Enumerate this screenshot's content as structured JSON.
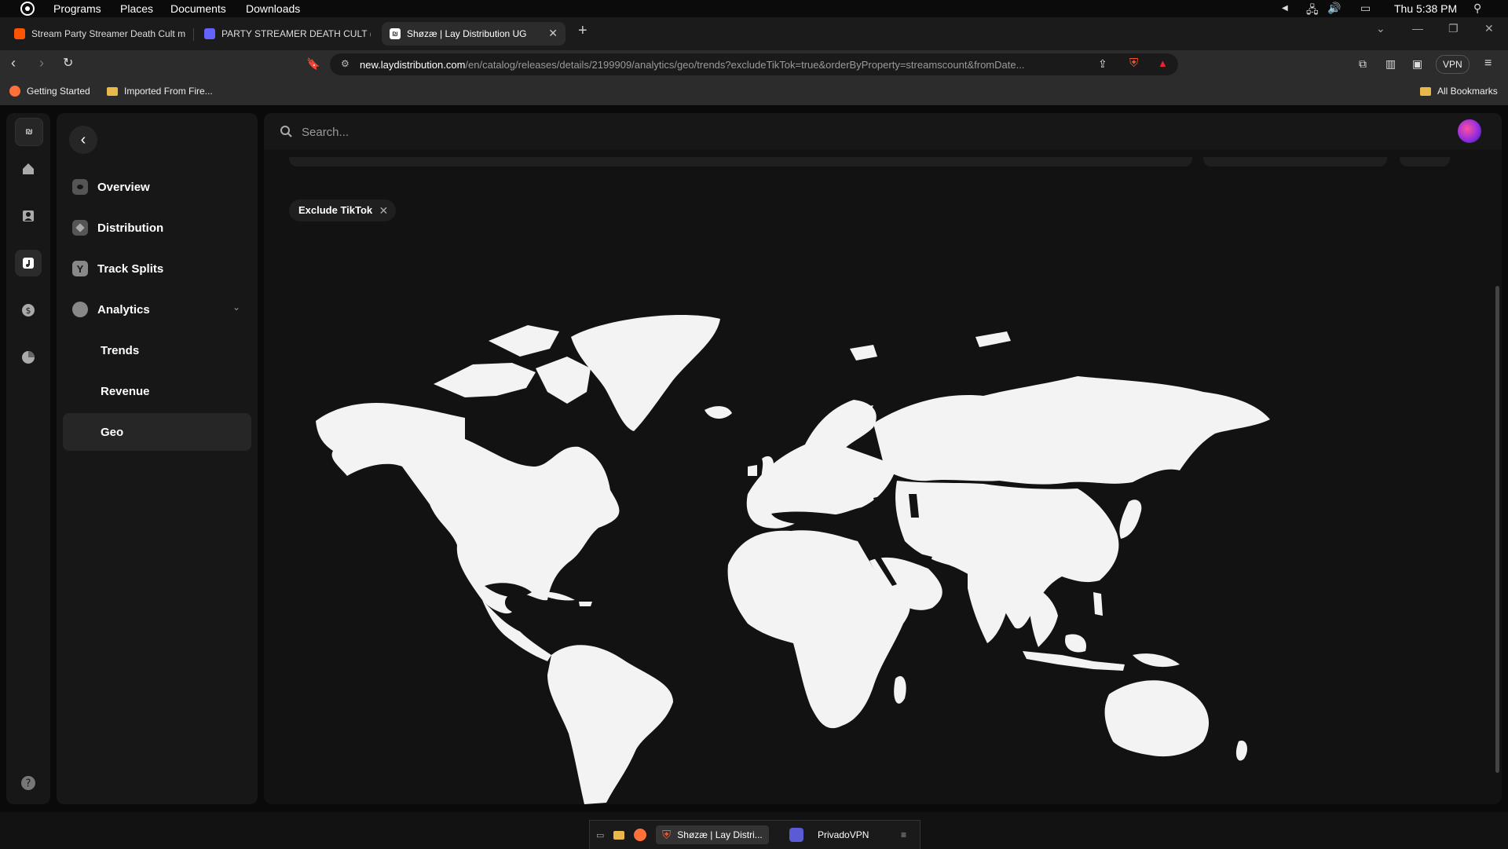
{
  "os": {
    "menus": [
      "Programs",
      "Places",
      "Documents",
      "Downloads"
    ],
    "clock": "Thu 5:38 PM"
  },
  "tabs": [
    {
      "title": "Stream Party Streamer Death Cult m",
      "favicon_color": "#ff5500"
    },
    {
      "title": "PARTY STREAMER DEATH CULT (@sh",
      "favicon_color": "#6364ff"
    },
    {
      "title": "Shøzæ | Lay Distribution UG",
      "favicon_color": "#333333",
      "active": true
    }
  ],
  "browser": {
    "url_host": "new.laydistribution.com",
    "url_path": "/en/catalog/releases/details/2199909/analytics/geo/trends?excludeTikTok=true&orderByProperty=streamscount&fromDate...",
    "vpn_label": "VPN"
  },
  "bookmarks": {
    "items": [
      "Getting Started",
      "Imported From Fire..."
    ],
    "all_label": "All Bookmarks"
  },
  "app": {
    "logo_text": "₪",
    "nav": {
      "overview": "Overview",
      "distribution": "Distribution",
      "track_splits": "Track Splits",
      "analytics": "Analytics",
      "trends": "Trends",
      "revenue": "Revenue",
      "geo": "Geo"
    },
    "search_placeholder": "Search...",
    "filter_chip": "Exclude TikTok",
    "map_land_color": "#f3f3f3"
  },
  "taskbar": {
    "items": [
      "Shøzæ | Lay Distri...",
      "PrivadoVPN"
    ]
  }
}
